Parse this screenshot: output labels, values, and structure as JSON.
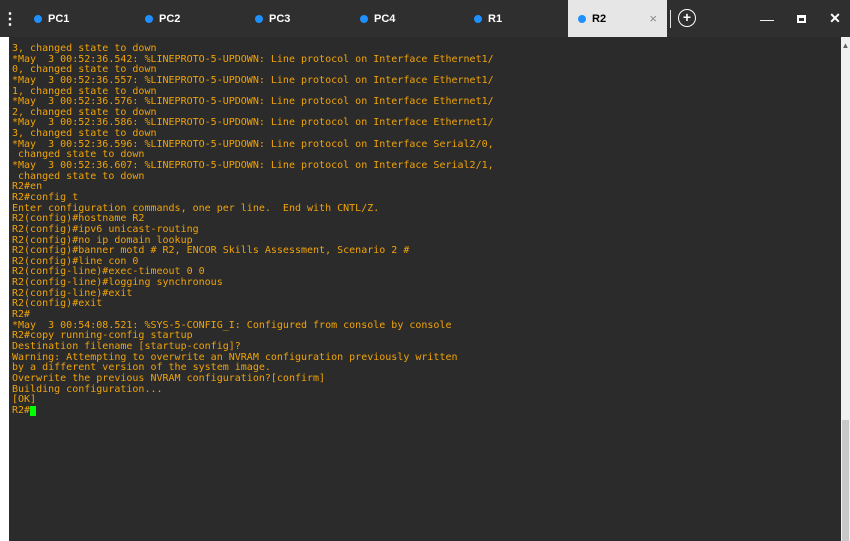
{
  "tabs": [
    {
      "label": "PC1"
    },
    {
      "label": "PC2"
    },
    {
      "label": "PC3"
    },
    {
      "label": "PC4"
    },
    {
      "label": "R1"
    },
    {
      "label": "R2",
      "active": true
    }
  ],
  "tab_close_glyph": "×",
  "new_tab_glyph": "+",
  "window": {
    "minimize_glyph": "—",
    "close_glyph": "✕"
  },
  "colors": {
    "terminal_text": "#f0a30a",
    "terminal_bg": "#2b2b2b",
    "tab_dot": "#1e90ff",
    "cursor": "#00ff00"
  },
  "terminal_lines": [
    "3, changed state to down",
    "*May  3 00:52:36.542: %LINEPROTO-5-UPDOWN: Line protocol on Interface Ethernet1/",
    "0, changed state to down",
    "*May  3 00:52:36.557: %LINEPROTO-5-UPDOWN: Line protocol on Interface Ethernet1/",
    "1, changed state to down",
    "*May  3 00:52:36.576: %LINEPROTO-5-UPDOWN: Line protocol on Interface Ethernet1/",
    "2, changed state to down",
    "*May  3 00:52:36.586: %LINEPROTO-5-UPDOWN: Line protocol on Interface Ethernet1/",
    "3, changed state to down",
    "*May  3 00:52:36.596: %LINEPROTO-5-UPDOWN: Line protocol on Interface Serial2/0,",
    " changed state to down",
    "*May  3 00:52:36.607: %LINEPROTO-5-UPDOWN: Line protocol on Interface Serial2/1,",
    " changed state to down",
    "R2#en",
    "R2#config t",
    "Enter configuration commands, one per line.  End with CNTL/Z.",
    "R2(config)#hostname R2",
    "R2(config)#ipv6 unicast-routing",
    "R2(config)#no ip domain lookup",
    "R2(config)#banner motd # R2, ENCOR Skills Assessment, Scenario 2 #",
    "R2(config)#line con 0",
    "R2(config-line)#exec-timeout 0 0",
    "R2(config-line)#logging synchronous",
    "R2(config-line)#exit",
    "R2(config)#exit",
    "R2#",
    "*May  3 00:54:08.521: %SYS-5-CONFIG_I: Configured from console by console",
    "R2#copy running-config startup",
    "Destination filename [startup-config]?",
    "Warning: Attempting to overwrite an NVRAM configuration previously written",
    "by a different version of the system image.",
    "Overwrite the previous NVRAM configuration?[confirm]",
    "Building configuration...",
    "[OK]"
  ],
  "prompt": "R2#"
}
